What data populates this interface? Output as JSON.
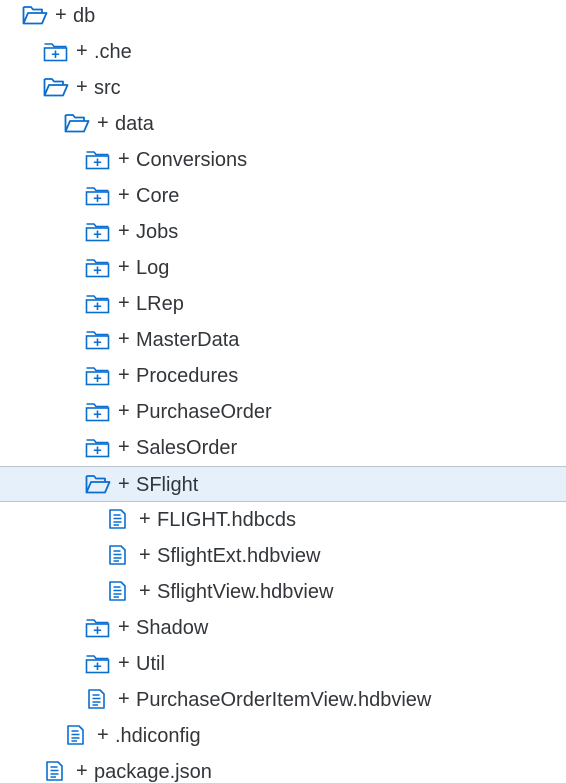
{
  "colors": {
    "icon": "#0a6ed1",
    "text": "#32363a",
    "selected_background": "#e5f0fa",
    "selected_border": "#bcc5cd"
  },
  "expander_symbol": "+",
  "tree": {
    "items": [
      {
        "label": "db",
        "icon": "folder-open-icon",
        "depth": 1
      },
      {
        "label": ".che",
        "icon": "folder-closed-icon",
        "depth": 2
      },
      {
        "label": "src",
        "icon": "folder-open-icon",
        "depth": 2
      },
      {
        "label": "data",
        "icon": "folder-open-icon",
        "depth": 3
      },
      {
        "label": "Conversions",
        "icon": "folder-closed-icon",
        "depth": 4
      },
      {
        "label": "Core",
        "icon": "folder-closed-icon",
        "depth": 4
      },
      {
        "label": "Jobs",
        "icon": "folder-closed-icon",
        "depth": 4
      },
      {
        "label": "Log",
        "icon": "folder-closed-icon",
        "depth": 4
      },
      {
        "label": "LRep",
        "icon": "folder-closed-icon",
        "depth": 4
      },
      {
        "label": "MasterData",
        "icon": "folder-closed-icon",
        "depth": 4
      },
      {
        "label": "Procedures",
        "icon": "folder-closed-icon",
        "depth": 4
      },
      {
        "label": "PurchaseOrder",
        "icon": "folder-closed-icon",
        "depth": 4
      },
      {
        "label": "SalesOrder",
        "icon": "folder-closed-icon",
        "depth": 4
      },
      {
        "label": "SFlight",
        "icon": "folder-open-icon",
        "depth": 4,
        "selected": true
      },
      {
        "label": "FLIGHT.hdbcds",
        "icon": "file-icon",
        "depth": 5
      },
      {
        "label": "SflightExt.hdbview",
        "icon": "file-icon",
        "depth": 5
      },
      {
        "label": "SflightView.hdbview",
        "icon": "file-icon",
        "depth": 5
      },
      {
        "label": "Shadow",
        "icon": "folder-closed-icon",
        "depth": 4
      },
      {
        "label": "Util",
        "icon": "folder-closed-icon",
        "depth": 4
      },
      {
        "label": "PurchaseOrderItemView.hdbview",
        "icon": "file-icon",
        "depth": 4
      },
      {
        "label": ".hdiconfig",
        "icon": "file-icon",
        "depth": 3
      },
      {
        "label": "package.json",
        "icon": "file-icon",
        "depth": 2
      }
    ]
  }
}
